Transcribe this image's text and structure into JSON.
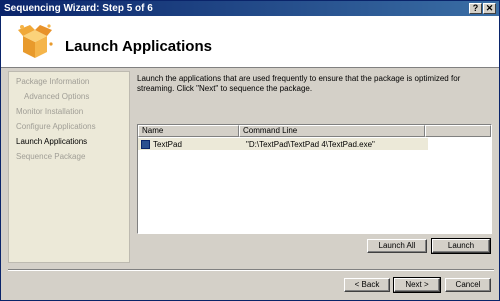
{
  "window": {
    "title": "Sequencing Wizard: Step 5 of 6",
    "help_button": "?",
    "close_button": "✕"
  },
  "header": {
    "title": "Launch Applications",
    "icon": "package-box-icon"
  },
  "sidebar": {
    "items": [
      {
        "label": "Package Information",
        "active": false,
        "indent": false
      },
      {
        "label": "Advanced Options",
        "active": false,
        "indent": true
      },
      {
        "label": "Monitor Installation",
        "active": false,
        "indent": false
      },
      {
        "label": "Configure Applications",
        "active": false,
        "indent": false
      },
      {
        "label": "Launch Applications",
        "active": true,
        "indent": false
      },
      {
        "label": "Sequence Package",
        "active": false,
        "indent": false
      }
    ]
  },
  "main": {
    "description": "Launch the applications that are used frequently to ensure that the package is optimized for streaming. Click \"Next\" to sequence the package.",
    "list": {
      "columns": [
        "Name",
        "Command Line"
      ],
      "rows": [
        {
          "name": "TextPad",
          "command": "\"D:\\TextPad\\TextPad 4\\TextPad.exe\"",
          "icon": "application-icon"
        }
      ]
    },
    "launch_all_label": "Launch All",
    "launch_label": "Launch"
  },
  "footer": {
    "back_label": "< Back",
    "next_label": "Next >",
    "cancel_label": "Cancel"
  },
  "colors": {
    "titlebar_start": "#0a246a",
    "titlebar_end": "#3a6ea5",
    "face": "#d4d0c8",
    "sidebar_bg": "#ece9d8"
  }
}
